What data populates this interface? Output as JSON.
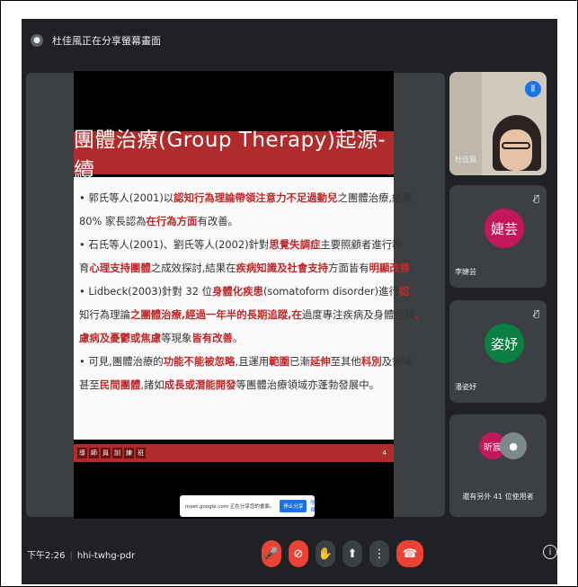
{
  "header": {
    "presenting_text": "杜佳風正在分享螢幕畫面"
  },
  "slide": {
    "title": "團體治療(Group Therapy)起源-續",
    "lines": [
      [
        "• 郭氏等人(2001)以",
        "認知行為理論帶領注意力不足過動兒",
        "之團體治療,結果"
      ],
      [
        "80% 家長認為",
        "在行為方面",
        "有改善。"
      ],
      [
        "• 石氏等人(2001)、劉氏等人(2002)針對",
        "思覺失調症",
        "主要照顧者進行教"
      ],
      [
        "育",
        "心理支持團體",
        "之成效探討,結果在",
        "疾病知識及社會支持",
        "方面皆有",
        "明顯改善",
        ";"
      ],
      [
        "• Lidbeck(2003)針對 32 位",
        "身體化疾患",
        "(somatoform disorder)進行",
        "認"
      ],
      [
        "知行為理論",
        "之團體治療,經過一年半的長期追蹤,在",
        "過度專注疾病及身體症狀",
        "、"
      ],
      [
        "",
        "慮病及憂鬱或焦慮",
        "等現象",
        "皆有改善",
        "。"
      ],
      [
        "• 可見,團體治療的",
        "功能不能被忽略",
        ",且運用",
        "範圍",
        "已漸",
        "延伸",
        "至其他",
        "科別",
        "及領域,"
      ],
      [
        "甚至",
        "民間團體",
        ",諸如",
        "成長或潛能開發",
        "等團體治療領域亦蓬勃發展中。"
      ]
    ],
    "footer_tags": [
      "導",
      "師",
      "員",
      "訓",
      "練",
      "班"
    ],
    "page_number": "4"
  },
  "share_banner": {
    "text": "meet.google.com 正在分享您的畫面。",
    "stop_label": "停止分享",
    "hide_label": "隱藏"
  },
  "participants": [
    {
      "name": "杜佳風",
      "speaking": true
    },
    {
      "name": "李婕芸",
      "initials": "婕芸",
      "muted": true
    },
    {
      "name": "潘姿妤",
      "initials": "姿妤",
      "muted": true
    }
  ],
  "others_tile": {
    "initials": "昕宸",
    "label": "還有另外 41 位使用者"
  },
  "bottom": {
    "time": "下午2:26",
    "meeting_code": "hhi-twhg-pdr"
  },
  "colors": {
    "accent_red": "#ea4335",
    "slide_red": "#b02b2b",
    "meet_bg": "#202124",
    "speaking_blue": "#1a73e8"
  }
}
